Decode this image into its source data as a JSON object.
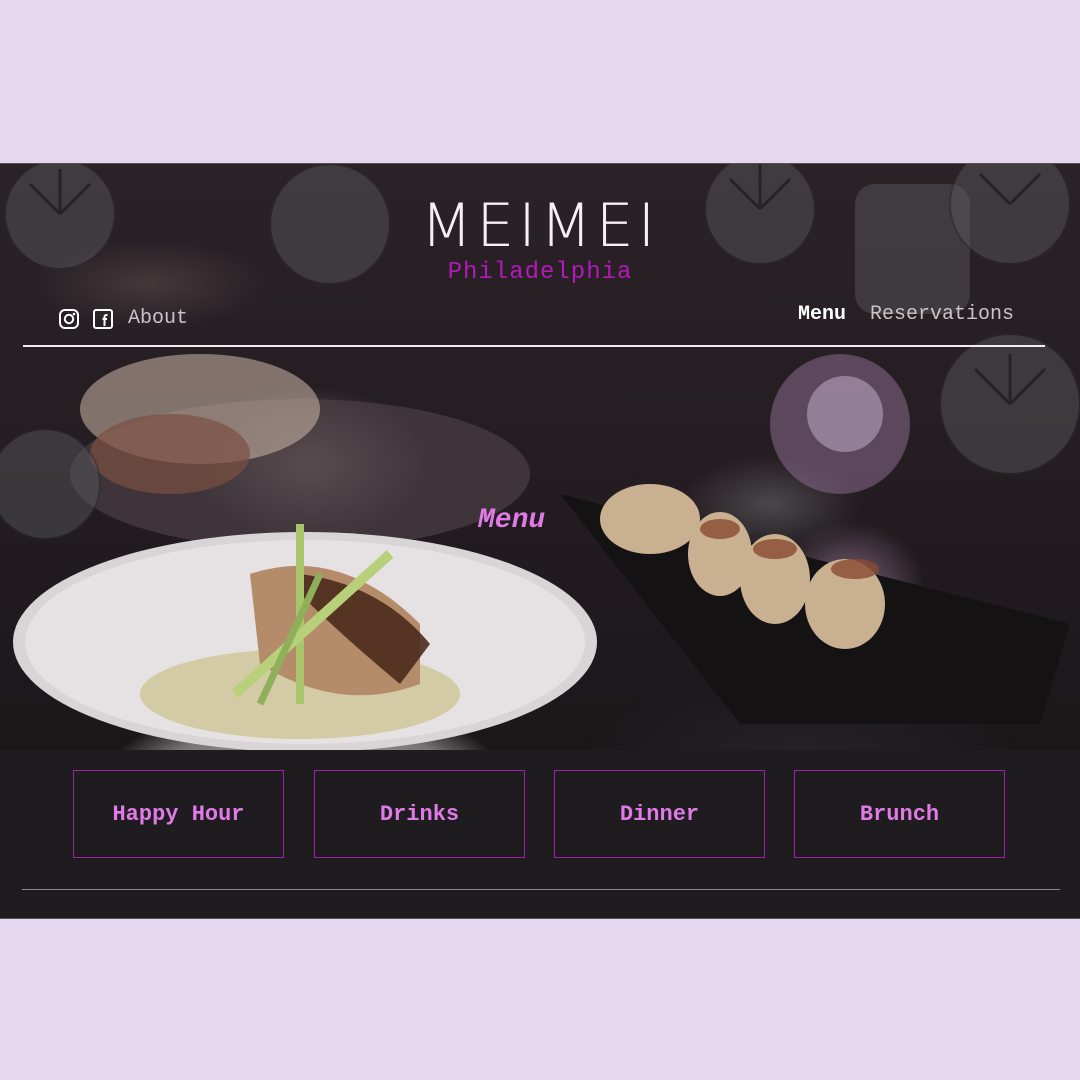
{
  "header": {
    "brand": "MEIMEI",
    "city": "Philadelphia",
    "about_label": "About",
    "social_icons": [
      "instagram-icon",
      "facebook-icon"
    ]
  },
  "nav": {
    "items": [
      {
        "label": "Menu",
        "active": true
      },
      {
        "label": "Reservations",
        "active": false
      }
    ]
  },
  "section": {
    "title": "Menu"
  },
  "categories": [
    "Happy Hour",
    "Drinks",
    "Dinner",
    "Brunch"
  ],
  "colors": {
    "page_background": "#e5d7f0",
    "accent_magenta": "#b21ab8",
    "accent_pink": "#e07ae6",
    "panel": "#1f1c1f"
  }
}
